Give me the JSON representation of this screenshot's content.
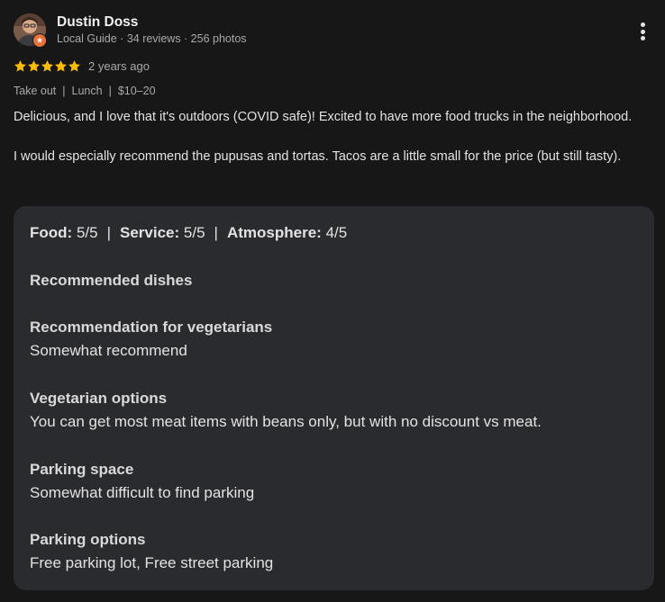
{
  "author": {
    "name": "Dustin Doss",
    "meta": "Local Guide · 34 reviews · 256 photos",
    "avatar_icon": "user-avatar",
    "badge_icon": "local-guide-badge-icon"
  },
  "rating": {
    "stars": 5,
    "max_stars": 5,
    "star_color": "#fbbc04",
    "date": "2 years ago"
  },
  "tags": [
    "Take out",
    "Lunch",
    "$10–20"
  ],
  "review_text": {
    "paragraph1": "Delicious, and I love that it's outdoors (COVID safe)! Excited to have more food trucks in the neighborhood.",
    "paragraph2": "I would especially recommend the pupusas and tortas. Tacos are a little small for the price (but still tasty)."
  },
  "subratings": {
    "food_label": "Food:",
    "food_value": "5/5",
    "service_label": "Service:",
    "service_value": "5/5",
    "atmosphere_label": "Atmosphere:",
    "atmosphere_value": "4/5",
    "separator": "|"
  },
  "details": [
    {
      "heading": "Recommended dishes",
      "value": ""
    },
    {
      "heading": "Recommendation for vegetarians",
      "value": "Somewhat recommend"
    },
    {
      "heading": "Vegetarian options",
      "value": "You can get most meat items with beans only, but with no discount vs meat."
    },
    {
      "heading": "Parking space",
      "value": "Somewhat difficult to find parking"
    },
    {
      "heading": "Parking options",
      "value": "Free parking lot, Free street parking"
    }
  ],
  "more_icon": "more-vert-icon",
  "colors": {
    "background": "#171718",
    "card": "#2a2b2e",
    "star": "#fbbc04",
    "badge": "#e8703a"
  }
}
